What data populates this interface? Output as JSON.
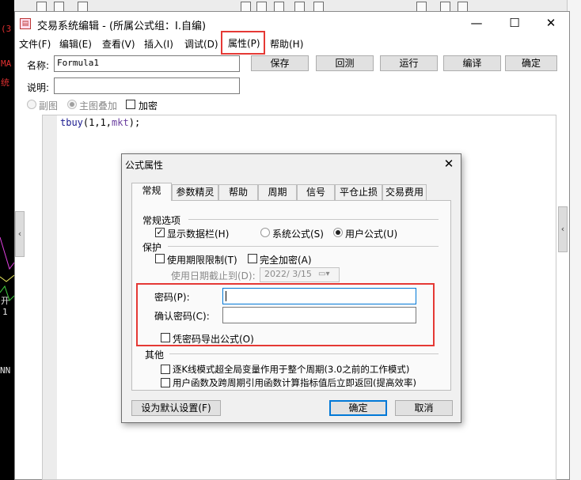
{
  "window": {
    "title": "交易系统编辑 - (所属公式组：I.自编)",
    "minimize": "—",
    "maximize": "☐",
    "close": "✕"
  },
  "menu": [
    "文件(F)",
    "编辑(E)",
    "查看(V)",
    "插入(I)",
    "调试(D)",
    "属性(P)",
    "帮助(H)"
  ],
  "form": {
    "name_label": "名称:",
    "name_value": "Formula1",
    "desc_label": "说明:",
    "desc_value": ""
  },
  "buttons": {
    "save": "保存",
    "goback": "回测",
    "run": "运行",
    "compile": "编译",
    "confirm": "确定"
  },
  "options": {
    "sub_chart": "副图",
    "main_overlay": "主图叠加",
    "encrypt": "加密"
  },
  "code": {
    "text": "tbuy(1,1,mkt);",
    "func": "tbuy",
    "args_pre": "(1,1,",
    "arg_id": "mkt",
    "args_post": ");"
  },
  "bg_chart": {
    "labels": [
      "(3",
      "MA",
      "统",
      "开",
      "1",
      "NN"
    ]
  },
  "dialog": {
    "title": "公式属性",
    "close": "✕",
    "tabs": [
      "常规",
      "参数精灵",
      "帮助",
      "周期",
      "信号",
      "平仓止损",
      "交易费用"
    ],
    "general": {
      "group": "常规选项",
      "show_data_bar": "显示数据栏(H)",
      "system_formula": "系统公式(S)",
      "user_formula": "用户公式(U)",
      "show_data_bar_checked": true,
      "selected_type": "user"
    },
    "protect": {
      "group": "保护",
      "use_time_limit": "使用期限限制(T)",
      "full_encrypt": "完全加密(A)",
      "expire_label": "使用日期截止到(D):",
      "expire_value": "2022/ 3/15",
      "password_label": "密码(P):",
      "confirm_password_label": "确认密码(C):",
      "password_value": "",
      "confirm_password_value": "",
      "export_with_password": "凭密码导出公式(O)"
    },
    "other": {
      "group": "其他",
      "option1": "逐K线模式超全局变量作用于整个周期(3.0之前的工作模式)",
      "option2": "用户函数及跨周期引用函数计算指标值后立即返回(提高效率)"
    },
    "footer": {
      "set_default": "设为默认设置(F)",
      "ok": "确定",
      "cancel": "取消"
    }
  },
  "colors": {
    "highlight": "#e53935",
    "default_button": "#0078d7",
    "chart_text": "#e03030"
  }
}
